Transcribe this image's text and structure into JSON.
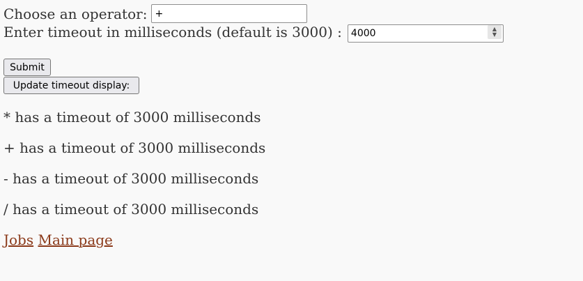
{
  "form": {
    "operator_label": "Choose an operator:",
    "operator_value": "+",
    "timeout_label": "Enter timeout in milliseconds (default is 3000) :",
    "timeout_value": "4000",
    "submit_label": "Submit",
    "update_label": "Update timeout display:"
  },
  "timeouts": [
    "* has a timeout of 3000 milliseconds",
    "+ has a timeout of 3000 milliseconds",
    "- has a timeout of 3000 milliseconds",
    "/ has a timeout of 3000 milliseconds"
  ],
  "links": {
    "jobs": "Jobs",
    "main_page": "Main page"
  },
  "colors": {
    "link": "#8b3a1a",
    "text": "#333333",
    "background": "#f9f9f9"
  },
  "icons": {
    "spinner": "number-spinner-icon"
  }
}
